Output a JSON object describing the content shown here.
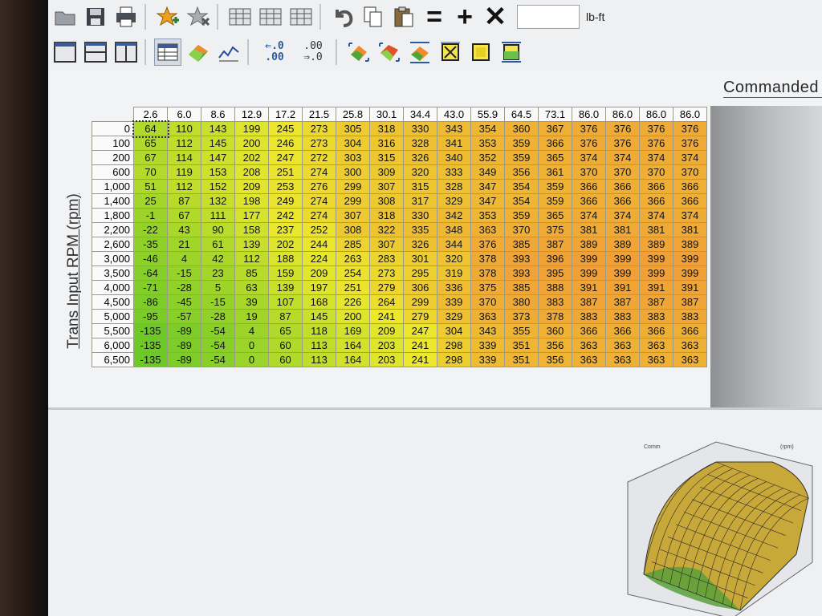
{
  "toolbar": {
    "unit_value": "",
    "unit_label": "lb-ft",
    "equals": "=",
    "plus": "+",
    "times": "✕",
    "dec_more_top": "⇐.0",
    "dec_more_bottom": ".00",
    "dec_less_top": ".00",
    "dec_less_bottom": "⇒.0"
  },
  "header": {
    "title": "Commanded"
  },
  "axis": {
    "y_label": "Trans Input RPM (rpm)"
  },
  "table": {
    "columns": [
      "2.6",
      "6.0",
      "8.6",
      "12.9",
      "17.2",
      "21.5",
      "25.8",
      "30.1",
      "34.4",
      "43.0",
      "55.9",
      "64.5",
      "73.1",
      "86.0",
      "86.0",
      "86.0",
      "86.0"
    ],
    "rows": [
      {
        "rpm": "0",
        "values": [
          64,
          110,
          143,
          199,
          245,
          273,
          305,
          318,
          330,
          343,
          354,
          360,
          367,
          376,
          376,
          376,
          376
        ]
      },
      {
        "rpm": "100",
        "values": [
          65,
          112,
          145,
          200,
          246,
          273,
          304,
          316,
          328,
          341,
          353,
          359,
          366,
          376,
          376,
          376,
          376
        ]
      },
      {
        "rpm": "200",
        "values": [
          67,
          114,
          147,
          202,
          247,
          272,
          303,
          315,
          326,
          340,
          352,
          359,
          365,
          374,
          374,
          374,
          374
        ]
      },
      {
        "rpm": "600",
        "values": [
          70,
          119,
          153,
          208,
          251,
          274,
          300,
          309,
          320,
          333,
          349,
          356,
          361,
          370,
          370,
          370,
          370
        ]
      },
      {
        "rpm": "1,000",
        "values": [
          51,
          112,
          152,
          209,
          253,
          276,
          299,
          307,
          315,
          328,
          347,
          354,
          359,
          366,
          366,
          366,
          366
        ]
      },
      {
        "rpm": "1,400",
        "values": [
          25,
          87,
          132,
          198,
          249,
          274,
          299,
          308,
          317,
          329,
          347,
          354,
          359,
          366,
          366,
          366,
          366
        ]
      },
      {
        "rpm": "1,800",
        "values": [
          -1,
          67,
          111,
          177,
          242,
          274,
          307,
          318,
          330,
          342,
          353,
          359,
          365,
          374,
          374,
          374,
          374
        ]
      },
      {
        "rpm": "2,200",
        "values": [
          -22,
          43,
          90,
          158,
          237,
          252,
          308,
          322,
          335,
          348,
          363,
          370,
          375,
          381,
          381,
          381,
          381
        ]
      },
      {
        "rpm": "2,600",
        "values": [
          -35,
          21,
          61,
          139,
          202,
          244,
          285,
          307,
          326,
          344,
          376,
          385,
          387,
          389,
          389,
          389,
          389
        ]
      },
      {
        "rpm": "3,000",
        "values": [
          -46,
          4,
          42,
          112,
          188,
          224,
          263,
          283,
          301,
          320,
          378,
          393,
          396,
          399,
          399,
          399,
          399
        ]
      },
      {
        "rpm": "3,500",
        "values": [
          -64,
          -15,
          23,
          85,
          159,
          209,
          254,
          273,
          295,
          319,
          378,
          393,
          395,
          399,
          399,
          399,
          399
        ]
      },
      {
        "rpm": "4,000",
        "values": [
          -71,
          -28,
          5,
          63,
          139,
          197,
          251,
          279,
          306,
          336,
          375,
          385,
          388,
          391,
          391,
          391,
          391
        ]
      },
      {
        "rpm": "4,500",
        "values": [
          -86,
          -45,
          -15,
          39,
          107,
          168,
          226,
          264,
          299,
          339,
          370,
          380,
          383,
          387,
          387,
          387,
          387
        ]
      },
      {
        "rpm": "5,000",
        "values": [
          -95,
          -57,
          -28,
          19,
          87,
          145,
          200,
          241,
          279,
          329,
          363,
          373,
          378,
          383,
          383,
          383,
          383
        ]
      },
      {
        "rpm": "5,500",
        "values": [
          -135,
          -89,
          -54,
          4,
          65,
          118,
          169,
          209,
          247,
          304,
          343,
          355,
          360,
          366,
          366,
          366,
          366
        ]
      },
      {
        "rpm": "6,000",
        "values": [
          -135,
          -89,
          -54,
          0,
          60,
          113,
          164,
          203,
          241,
          298,
          339,
          351,
          356,
          363,
          363,
          363,
          363
        ]
      },
      {
        "rpm": "6,500",
        "values": [
          -135,
          -89,
          -54,
          0,
          60,
          113,
          164,
          203,
          241,
          298,
          339,
          351,
          356,
          363,
          363,
          363,
          363
        ]
      }
    ]
  },
  "graph": {
    "label_top": "Comm",
    "label_right": "(rpm)"
  },
  "colors": {
    "low": "#6fcf2a",
    "mid": "#e6e62e",
    "high": "#f0a33a"
  }
}
